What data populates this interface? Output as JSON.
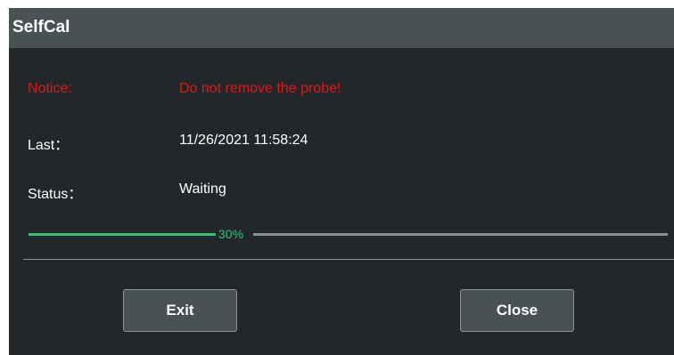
{
  "dialog": {
    "title": "SelfCal",
    "notice_label": "Notice:",
    "notice_text": "Do not remove the probe!",
    "last_label": "Last：",
    "last_value": "11/26/2021 11:58:24",
    "status_label": "Status：",
    "status_value": "Waiting",
    "progress": {
      "percent_text": "30%",
      "value": 0.3,
      "fill_color": "#2ec47a",
      "track_color": "#8a8f91"
    },
    "buttons": {
      "exit": "Exit",
      "close": "Close"
    },
    "colors": {
      "background": "#222729",
      "titlebar": "#4a5154",
      "notice": "#e11717"
    }
  }
}
